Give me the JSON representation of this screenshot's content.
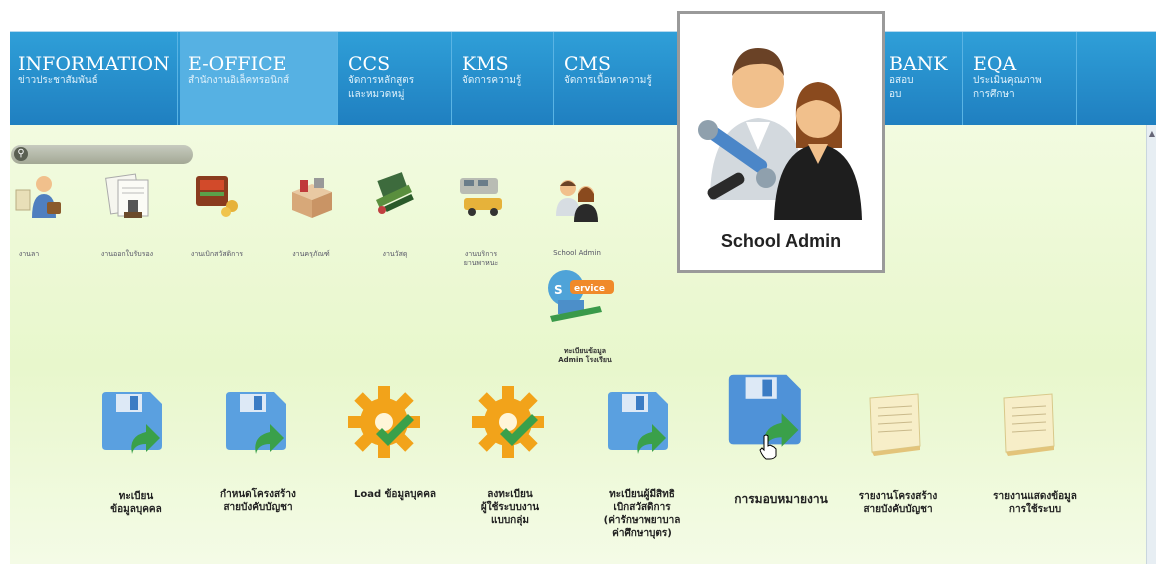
{
  "nav": [
    {
      "title": "INFORMATION",
      "sub": "ข่าวประชาสัมพันธ์",
      "sub2": ""
    },
    {
      "title": "E-OFFICE",
      "sub": "สำนักงานอิเล็คทรอนิกส์",
      "sub2": ""
    },
    {
      "title": "CCS",
      "sub": "จัดการหลักสูตร",
      "sub2": "และหมวดหมู่"
    },
    {
      "title": "KMS",
      "sub": "จัดการความรู้",
      "sub2": ""
    },
    {
      "title": "CMS",
      "sub": "จัดการเนื้อหาความรู้",
      "sub2": ""
    },
    {
      "title": "BANK",
      "sub": "อสอบ",
      "sub2": "อบ"
    },
    {
      "title": "EQA",
      "sub": "ประเมินคุณภาพ",
      "sub2": "การศึกษา"
    }
  ],
  "small_icons": [
    {
      "label": "งานลา",
      "sub": ""
    },
    {
      "label": "งานออกใบรับรอง",
      "sub": ""
    },
    {
      "label": "งานเบิกสวัสดิการ",
      "sub": ""
    },
    {
      "label": "งานครุภัณฑ์",
      "sub": ""
    },
    {
      "label": "งานวัสดุ",
      "sub": ""
    },
    {
      "label": "งานบริการ",
      "sub": "ยานพาหนะ"
    },
    {
      "label": "School Admin",
      "sub": ""
    }
  ],
  "service_icon": {
    "label": "ทะเบียนข้อมูล",
    "sub": "Admin โรงเรียน"
  },
  "big_icons": [
    {
      "l1": "ทะเบียน",
      "l2": "ข้อมูลบุคคล",
      "l3": "",
      "l4": ""
    },
    {
      "l1": "กำหนดโครงสร้าง",
      "l2": "สายบังคับบัญชา",
      "l3": "",
      "l4": ""
    },
    {
      "l1": "Load ข้อมูลบุคคล",
      "l2": "",
      "l3": "",
      "l4": ""
    },
    {
      "l1": "ลงทะเบียน",
      "l2": "ผู้ใช้ระบบงาน",
      "l3": "แบบกลุ่ม",
      "l4": ""
    },
    {
      "l1": "ทะเบียนผู้มีสิทธิ",
      "l2": "เบิกสวัสดิการ",
      "l3": "(ค่ารักษาพยาบาล",
      "l4": "ค่าศึกษาบุตร)"
    },
    {
      "l1": "การมอบหมายงาน",
      "l2": "",
      "l3": "",
      "l4": ""
    },
    {
      "l1": "รายงานโครงสร้าง",
      "l2": "สายบังคับบัญชา",
      "l3": "",
      "l4": ""
    },
    {
      "l1": "รายงานแสดงข้อมูล",
      "l2": "การใช้ระบบ",
      "l3": "",
      "l4": ""
    }
  ],
  "popup": {
    "title": "School Admin"
  },
  "colors": {
    "nav": "#2f9fd8",
    "nav_active": "#56b1e3",
    "content_bg": "#eef9d8"
  }
}
